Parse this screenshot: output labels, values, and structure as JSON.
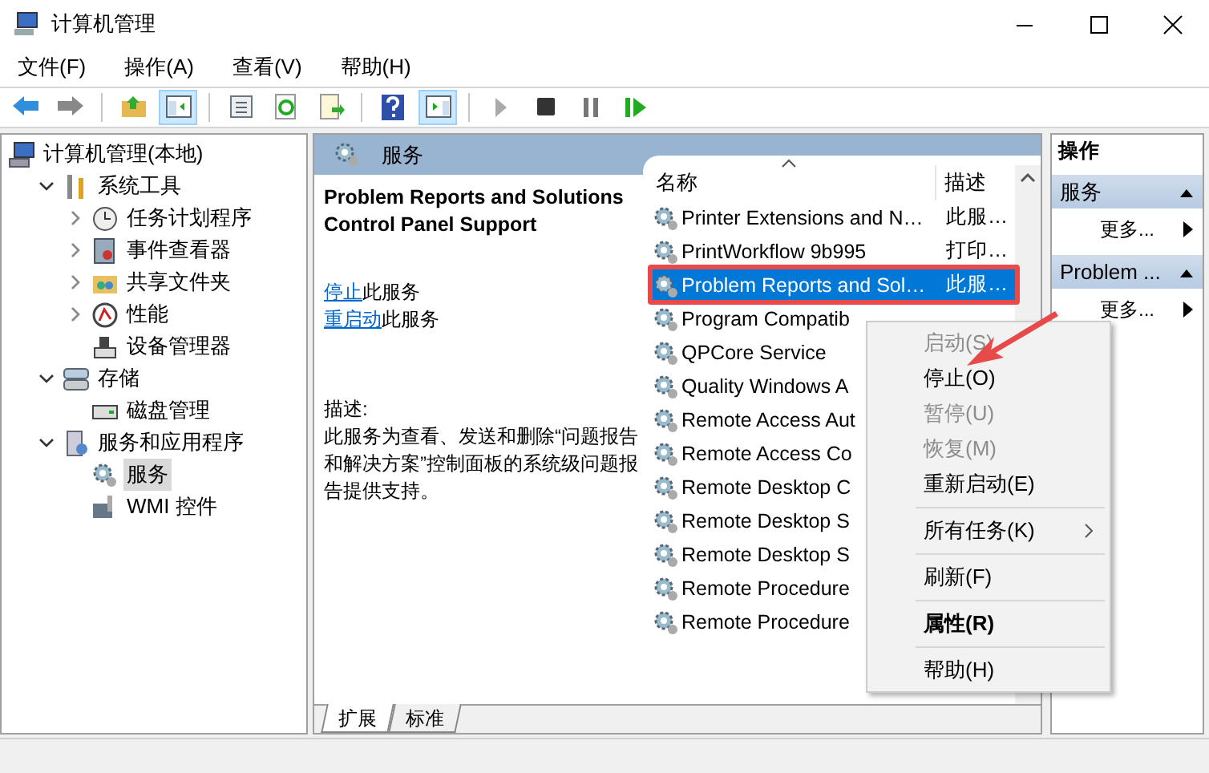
{
  "window": {
    "title": "计算机管理"
  },
  "menu_bar": [
    "文件(F)",
    "操作(A)",
    "查看(V)",
    "帮助(H)"
  ],
  "toolbar": [
    [
      {
        "kind": "back",
        "on": false
      },
      {
        "kind": "forward",
        "on": false
      }
    ],
    [
      {
        "kind": "up",
        "on": false
      },
      {
        "kind": "tree",
        "on": true
      }
    ],
    [
      {
        "kind": "props",
        "on": false
      },
      {
        "kind": "refresh",
        "on": false
      },
      {
        "kind": "export",
        "on": false
      }
    ],
    [
      {
        "kind": "help",
        "on": false
      },
      {
        "kind": "actionpane",
        "on": true
      }
    ],
    [
      {
        "kind": "play",
        "on": false
      },
      {
        "kind": "stop",
        "on": false
      },
      {
        "kind": "pause",
        "on": false
      },
      {
        "kind": "resume",
        "on": false
      }
    ]
  ],
  "tree": [
    {
      "label": "计算机管理(本地)",
      "selected": false,
      "children": [
        {
          "label": "系统工具",
          "expanded": true,
          "selected": false,
          "children": [
            {
              "label": "任务计划程序",
              "expanded": false,
              "selected": false
            },
            {
              "label": "事件查看器",
              "expanded": false,
              "selected": false
            },
            {
              "label": "共享文件夹",
              "expanded": false,
              "selected": false
            },
            {
              "label": "性能",
              "expanded": false,
              "selected": false
            },
            {
              "label": "设备管理器",
              "selected": false
            }
          ]
        },
        {
          "label": "存储",
          "expanded": true,
          "selected": false,
          "children": [
            {
              "label": "磁盘管理",
              "selected": false
            }
          ]
        },
        {
          "label": "服务和应用程序",
          "expanded": true,
          "selected": false,
          "children": [
            {
              "label": "服务",
              "selected": true
            },
            {
              "label": "WMI 控件",
              "selected": false
            }
          ]
        }
      ]
    }
  ],
  "center_title": "服务",
  "detail": {
    "title": "Problem Reports and Solutions Control Panel Support",
    "actions": [
      {
        "link": "停止",
        "text": "此服务"
      },
      {
        "link": "重启动",
        "text": "此服务"
      }
    ],
    "description_label": "描述:",
    "description": "此服务为查看、发送和删除“问题报告和解决方案”控制面板的系统级问题报告提供支持。"
  },
  "list": {
    "columns": [
      "名称",
      "描述"
    ],
    "rows": [
      {
        "name": "Printer Extensions and N…",
        "description": "此服…",
        "selected": false,
        "outlined": false
      },
      {
        "name": "PrintWorkflow 9b995",
        "description": "打印…",
        "selected": false,
        "outlined": false
      },
      {
        "name": "Problem Reports and Sol…",
        "description": "此服…",
        "selected": true,
        "outlined": true
      },
      {
        "name": "Program Compatib",
        "selected": false,
        "outlined": false
      },
      {
        "name": "QPCore Service",
        "selected": false,
        "outlined": false
      },
      {
        "name": "Quality Windows A",
        "selected": false,
        "outlined": false
      },
      {
        "name": "Remote Access Aut",
        "selected": false,
        "outlined": false
      },
      {
        "name": "Remote Access Co",
        "selected": false,
        "outlined": false
      },
      {
        "name": "Remote Desktop C",
        "selected": false,
        "outlined": false
      },
      {
        "name": "Remote Desktop S",
        "selected": false,
        "outlined": false
      },
      {
        "name": "Remote Desktop S",
        "selected": false,
        "outlined": false
      },
      {
        "name": "Remote Procedure",
        "selected": false,
        "outlined": false
      },
      {
        "name": "Remote Procedure",
        "selected": false,
        "outlined": false
      }
    ]
  },
  "tabs": [
    {
      "label": "扩展",
      "selected": true
    },
    {
      "label": "标准",
      "selected": false
    }
  ],
  "actions_pane": {
    "title": "操作",
    "sections": [
      {
        "title": "服务",
        "expanded": true,
        "items": [
          "更多..."
        ]
      },
      {
        "title": "Problem ...",
        "expanded": true,
        "items": [
          "更多..."
        ]
      }
    ]
  },
  "context_menu": [
    {
      "kind": "item",
      "label": "启动(S)",
      "disabled": true,
      "bold": false,
      "submenu": false
    },
    {
      "kind": "item",
      "label": "停止(O)",
      "disabled": false,
      "bold": false,
      "submenu": false
    },
    {
      "kind": "item",
      "label": "暂停(U)",
      "disabled": true,
      "bold": false,
      "submenu": false
    },
    {
      "kind": "item",
      "label": "恢复(M)",
      "disabled": true,
      "bold": false,
      "submenu": false
    },
    {
      "kind": "item",
      "label": "重新启动(E)",
      "disabled": false,
      "bold": false,
      "submenu": false
    },
    {
      "kind": "separator"
    },
    {
      "kind": "item",
      "label": "所有任务(K)",
      "disabled": false,
      "bold": false,
      "submenu": true
    },
    {
      "kind": "separator"
    },
    {
      "kind": "item",
      "label": "刷新(F)",
      "disabled": false,
      "bold": false,
      "submenu": false
    },
    {
      "kind": "separator"
    },
    {
      "kind": "item",
      "label": "属性(R)",
      "disabled": false,
      "bold": true,
      "submenu": false
    },
    {
      "kind": "separator"
    },
    {
      "kind": "item",
      "label": "帮助(H)",
      "disabled": false,
      "bold": false,
      "submenu": false
    }
  ]
}
